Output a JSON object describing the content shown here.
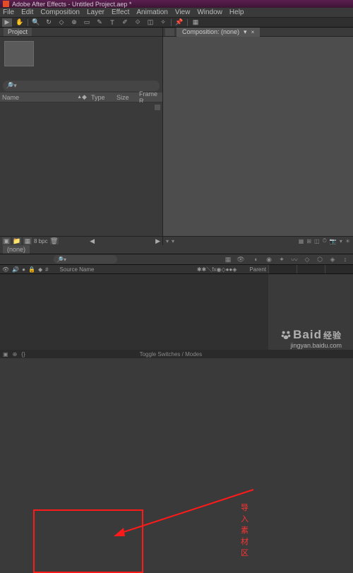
{
  "titlebar": {
    "title": "Adobe After Effects - Untitled Project.aep *"
  },
  "menu": [
    "File",
    "Edit",
    "Composition",
    "Layer",
    "Effect",
    "Animation",
    "View",
    "Window",
    "Help"
  ],
  "panels": {
    "project": {
      "tab": "Project",
      "search_placeholder": "",
      "columns": {
        "name": "Name",
        "type": "Type",
        "size": "Size",
        "frame": "Frame R..."
      },
      "bpc": "8 bpc"
    },
    "composition": {
      "tab": "Composition: (none)"
    }
  },
  "timeline": {
    "tab": "(none)",
    "search_placeholder": "",
    "columns": {
      "num": "#",
      "source": "Source Name",
      "parent": "Parent"
    },
    "footer": {
      "toggle": "Toggle Switches / Modes"
    }
  },
  "annotation": {
    "label": "导入素材区"
  },
  "watermark": {
    "main": "Baid",
    "sub1": "经验",
    "sub2": "jingyan.baidu.com"
  }
}
